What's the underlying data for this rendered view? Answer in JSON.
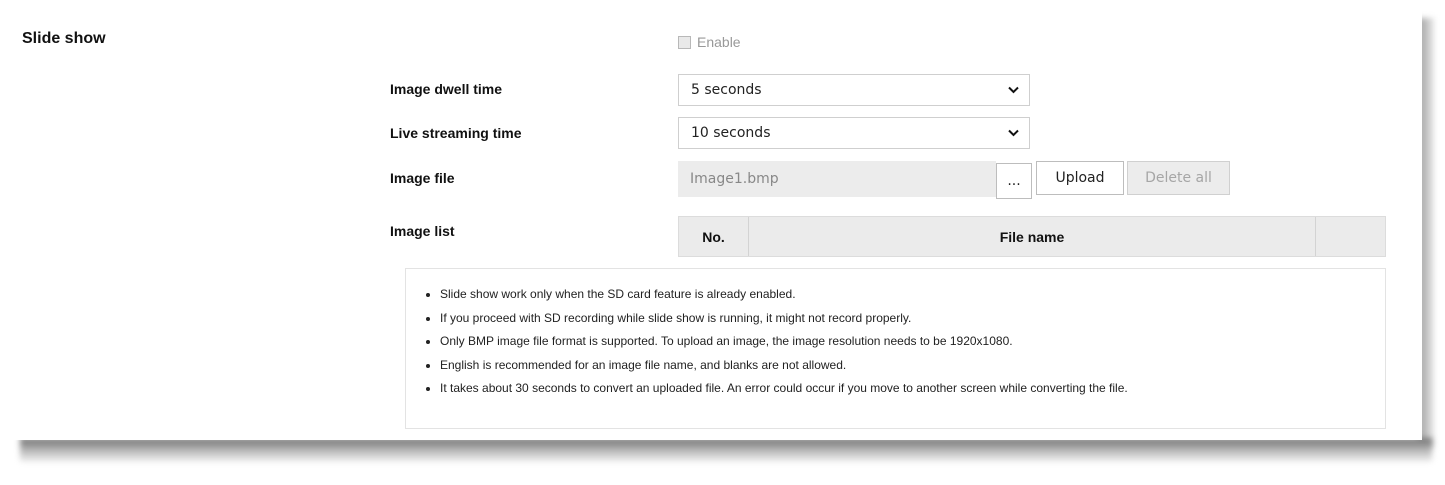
{
  "section": {
    "title": "Slide show"
  },
  "enable": {
    "label": "Enable",
    "checked": false
  },
  "dwell": {
    "label": "Image dwell time",
    "value": "5 seconds"
  },
  "streaming": {
    "label": "Live streaming time",
    "value": "10 seconds"
  },
  "image_file": {
    "label": "Image file",
    "value": "Image1.bmp",
    "browse_label": "...",
    "upload_label": "Upload",
    "delete_all_label": "Delete all"
  },
  "image_list": {
    "label": "Image list",
    "columns": [
      "No.",
      "File name",
      ""
    ]
  },
  "notes": [
    "Slide show work only when the SD card feature is already enabled.",
    "If you proceed with SD recording while slide show is running, it might not record properly.",
    "Only BMP image file format is supported. To upload an image, the image resolution needs to be 1920x1080.",
    "English is recommended for an image file name, and blanks are not allowed.",
    "It takes about 30 seconds to convert an uploaded file. An error could occur if you move to another screen while converting the file."
  ],
  "icons": {
    "dropdown": "chevron-down-icon"
  }
}
